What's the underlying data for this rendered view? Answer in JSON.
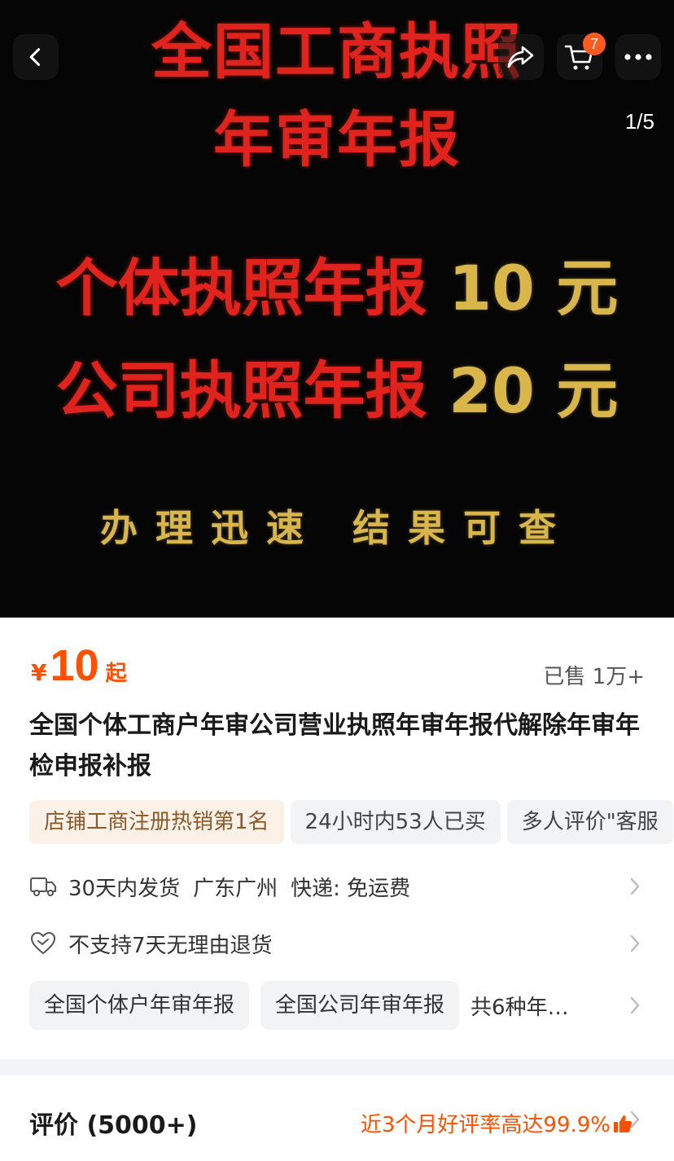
{
  "hero": {
    "line1": "全国工商执照",
    "line2": "年审年报",
    "line3_text": "个体执照年报",
    "line3_price": " 10 元",
    "line4_text": "公司执照年报",
    "line4_price": " 20 元",
    "line5": "办理迅速 结果可查",
    "pager": "1/5"
  },
  "topbar": {
    "cart_count": "7",
    "icons": [
      "back-icon",
      "share-icon",
      "cart-icon",
      "more-icon"
    ]
  },
  "price": {
    "symbol": "¥",
    "value": "10",
    "suffix": "起",
    "sold": "已售 1万+"
  },
  "title": "全国个体工商户年审公司营业执照年审年报代解除年审年检申报补报",
  "tags": [
    "店铺工商注册热销第1名",
    "24小时内53人已买",
    "多人评价\"客服"
  ],
  "shipping": {
    "time": "30天内发货",
    "location": "广东广州",
    "method": "快递: 免运费"
  },
  "return_policy": "不支持7天无理由退货",
  "skus": [
    "全国个体户年审年报",
    "全国公司年审年报",
    "共6种年…"
  ],
  "review": {
    "title": "评价 (5000+)",
    "rate": "近3个月好评率高达99.9%"
  },
  "colors": {
    "accent": "#ff5000",
    "badge": "#ff5a1f",
    "hero_red": "#e0231c",
    "hero_gold": "#d9b64b"
  }
}
